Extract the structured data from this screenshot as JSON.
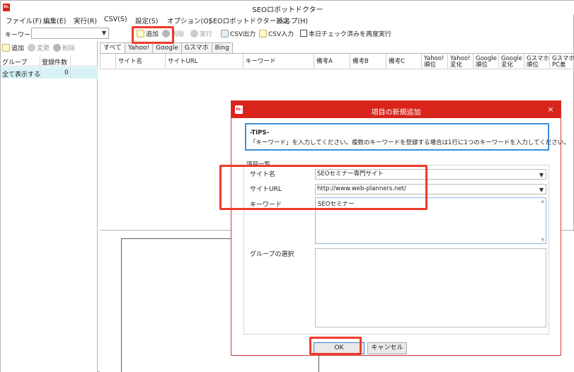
{
  "app": {
    "title": "SEOロボットドクター",
    "icon_text": "Dr."
  },
  "menu": [
    "ファイル(F)",
    "編集(E)",
    "実行(R)",
    "CSV(S)",
    "設定(S)",
    "オプション(O)",
    "SEOロボットドクター設定",
    "ヘルプ(H)"
  ],
  "toolbar": {
    "keyword_label": "キーワード",
    "keyword_value": "",
    "add": "追加",
    "delete": "削除",
    "execute": "実行",
    "csv_out": "CSV出力",
    "csv_in": "CSV入力",
    "recheck": "本日チェック済みを再度実行"
  },
  "left_panel": {
    "add": "追加",
    "change": "変更",
    "delete": "削除",
    "col_group": "グループ",
    "col_count": "登録件数",
    "row_group": "全て表示する",
    "row_count": "0"
  },
  "tabs": [
    "すべて",
    "Yahoo!",
    "Google",
    "Gスマホ",
    "Bing"
  ],
  "grid_columns": [
    "サイト名",
    "サイトURL",
    "キーワード",
    "備考A",
    "備考B",
    "備考C",
    "Yahoo!\n順位",
    "Yahoo!\n変化",
    "Google\n順位",
    "Google\n変化",
    "Gスマホ\n順位",
    "Gスマホ\nPC差"
  ],
  "dialog": {
    "title": "項目の新規追加",
    "close": "×",
    "tips_title": "-TIPS-",
    "tips_text": "「キーワード」を入力してください。複数のキーワードを登録する場合は1行に1つのキーワードを入力してください。",
    "section_label": "項目一覧",
    "site_name_label": "サイト名",
    "site_name_value": "SEOセミナー専門サイト",
    "site_url_label": "サイトURL",
    "site_url_value": "http://www.web-planners.net/",
    "keyword_label": "キーワード",
    "keyword_value": "SEOセミナー",
    "group_label": "グループの選択",
    "ok": "OK",
    "cancel": "キャンセル"
  },
  "colors": {
    "accent_red": "#d9241b",
    "highlight_red": "#ee3b2b",
    "tips_border": "#3b8fe0",
    "selected_row": "#d7f3f8"
  }
}
